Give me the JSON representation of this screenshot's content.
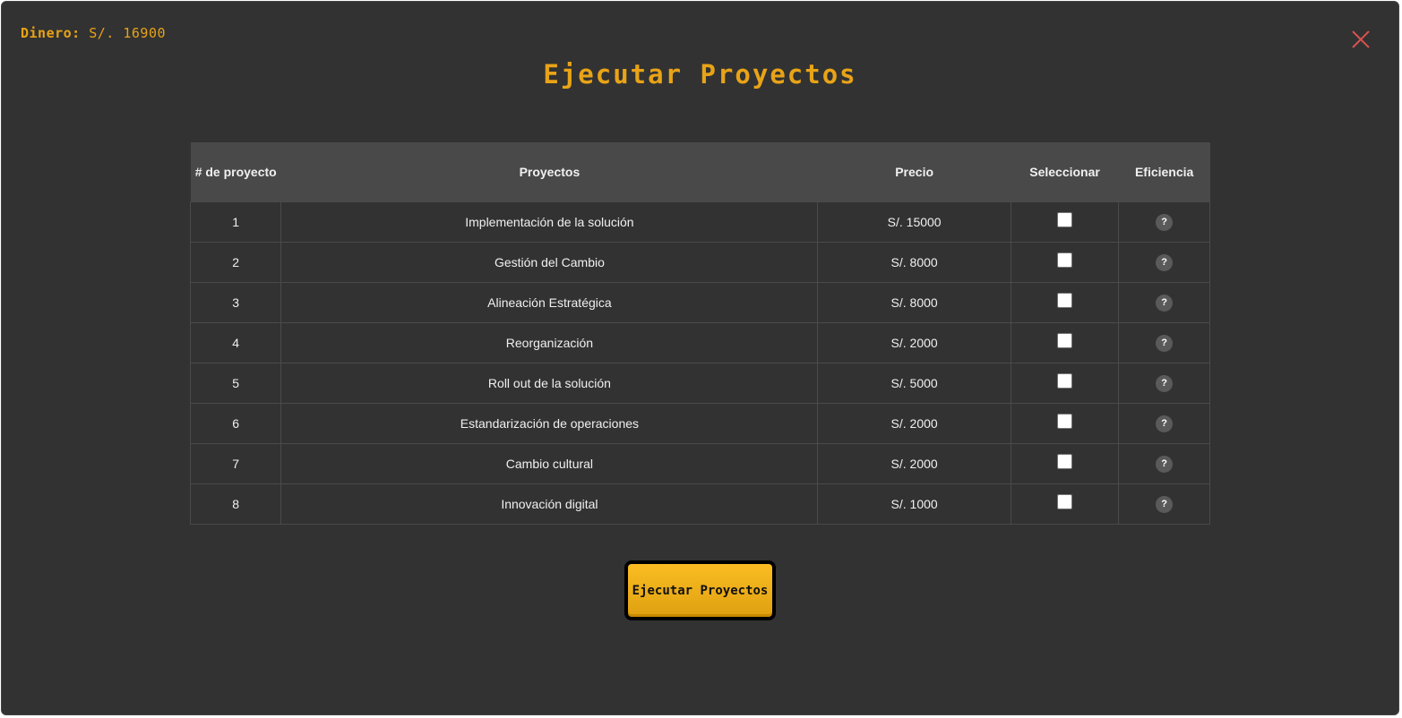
{
  "money": {
    "label": "Dinero:",
    "value": "S/. 16900"
  },
  "dialog": {
    "title": "Ejecutar Proyectos"
  },
  "table": {
    "headers": [
      "# de proyecto",
      "Proyectos",
      "Precio",
      "Seleccionar",
      "Eficiencia"
    ],
    "rows": [
      {
        "num": "1",
        "name": "Implementación de la solución",
        "price": "S/. 15000",
        "selected": false,
        "help": "?"
      },
      {
        "num": "2",
        "name": "Gestión del Cambio",
        "price": "S/. 8000",
        "selected": false,
        "help": "?"
      },
      {
        "num": "3",
        "name": "Alineación Estratégica",
        "price": "S/. 8000",
        "selected": false,
        "help": "?"
      },
      {
        "num": "4",
        "name": "Reorganización",
        "price": "S/. 2000",
        "selected": false,
        "help": "?"
      },
      {
        "num": "5",
        "name": "Roll out de la solución",
        "price": "S/. 5000",
        "selected": false,
        "help": "?"
      },
      {
        "num": "6",
        "name": "Estandarización de operaciones",
        "price": "S/. 2000",
        "selected": false,
        "help": "?"
      },
      {
        "num": "7",
        "name": "Cambio cultural",
        "price": "S/. 2000",
        "selected": false,
        "help": "?"
      },
      {
        "num": "8",
        "name": "Innovación digital",
        "price": "S/. 1000",
        "selected": false,
        "help": "?"
      }
    ]
  },
  "actions": {
    "execute_label": "Ejecutar Proyectos"
  },
  "icons": {
    "close": "close-icon",
    "help": "question-icon"
  },
  "colors": {
    "accent": "#e8a317",
    "background": "#323232",
    "header": "#494949",
    "close": "#d9534f",
    "button": "#fbbd22"
  }
}
